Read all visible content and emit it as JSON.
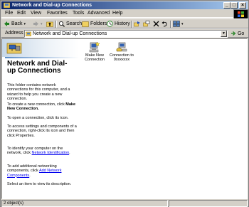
{
  "window": {
    "title": "Network and Dial-up Connections"
  },
  "menu": [
    "File",
    "Edit",
    "View",
    "Favorites",
    "Tools",
    "Advanced",
    "Help"
  ],
  "toolbar": {
    "back_label": "Back",
    "search_label": "Search",
    "folders_label": "Folders",
    "history_label": "History"
  },
  "address": {
    "label": "Address",
    "value": "Network and Dial-up Connections",
    "go_label": "Go"
  },
  "leftpane": {
    "title": "Network and Dial-up Connections",
    "intro": "This folder contains network connections for this computer, and a wizard to help you create a new connection.",
    "create_text": "To create a new connection, click",
    "create_bold": "Make New Connection.",
    "open_text": "To open a connection, click its icon.",
    "settings_text": "To access settings and components of a connection, right-click its icon and then click Properties.",
    "identify_text": "To identify your computer on the network, click",
    "identify_link": "Network Identification",
    "add_text": "To add additional networking components, click",
    "add_link": "Add Network Components",
    "select_text": "Select an item to view its description."
  },
  "items": [
    {
      "label_line1": "Make New",
      "label_line2": "Connection",
      "icon": "make-new-connection-icon"
    },
    {
      "label_line1": "Connection to",
      "label_line2": "9xxxxxxx",
      "icon": "dialup-connection-icon"
    }
  ],
  "status": {
    "objects": "2 object(s)"
  }
}
